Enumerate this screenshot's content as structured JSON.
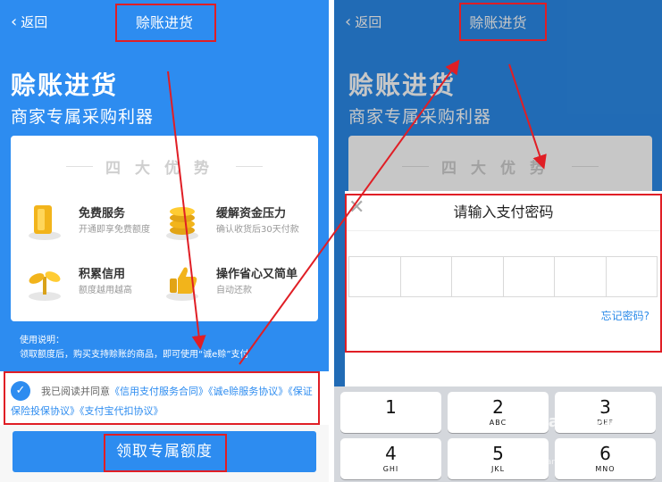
{
  "left": {
    "nav": {
      "back": "返回",
      "title": "赊账进货"
    },
    "hero": {
      "title": "赊账进货",
      "subtitle": "商家专属采购利器"
    },
    "card": {
      "heading": "四大优势",
      "features": [
        {
          "title": "免费服务",
          "desc": "开通即享免费额度",
          "icon": "gold-bar-icon"
        },
        {
          "title": "缓解资金压力",
          "desc": "确认收货后30天付款",
          "icon": "coin-stack-icon"
        },
        {
          "title": "积累信用",
          "desc": "额度越用越高",
          "icon": "sprout-icon"
        },
        {
          "title": "操作省心又简单",
          "desc": "自动还款",
          "icon": "thumbs-up-icon"
        }
      ]
    },
    "usage": {
      "label": "使用说明：",
      "text": "领取额度后，购买支持赊账的商品，即可使用“诚e赊”支付"
    },
    "agreement": {
      "prefix": "我已阅读并同意",
      "links": [
        "《信用支付服务合同》",
        "《诚e赊服务协议》",
        "《保证保险投保协议》",
        "《支付宝代扣协议》"
      ]
    },
    "cta": "领取专属额度"
  },
  "right": {
    "nav": {
      "back": "返回",
      "title": "赊账进货"
    },
    "hero": {
      "title": "赊账进货",
      "subtitle": "商家专属采购利器"
    },
    "card": {
      "heading": "四大优势"
    },
    "sheet": {
      "title": "请输入支付密码",
      "forgot": "忘记密码?"
    },
    "keypad": [
      {
        "num": "1",
        "letters": ""
      },
      {
        "num": "2",
        "letters": "ABC"
      },
      {
        "num": "3",
        "letters": "DEF"
      },
      {
        "num": "4",
        "letters": "GHI"
      },
      {
        "num": "5",
        "letters": "JKL"
      },
      {
        "num": "6",
        "letters": "MNO"
      }
    ]
  },
  "watermark": {
    "logo": "Baidu经验",
    "url": "jingyan.baidu.com"
  },
  "colors": {
    "brand_blue": "#2d8cf0",
    "highlight_red": "#e01e25"
  }
}
